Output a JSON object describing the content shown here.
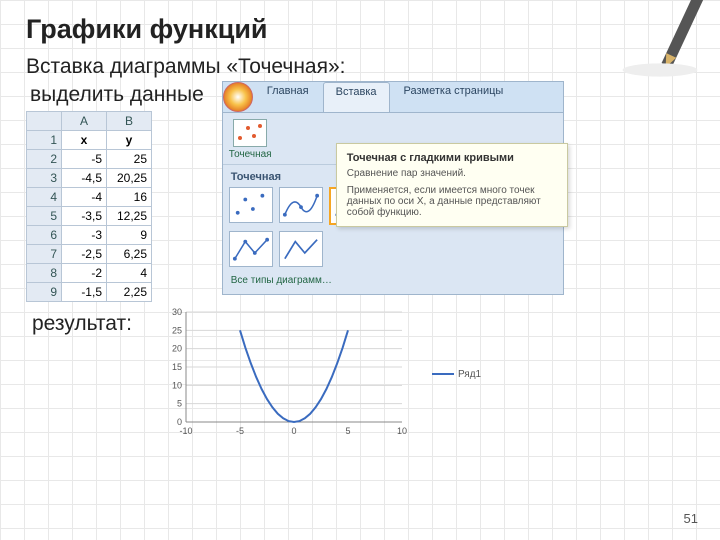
{
  "title": "Графики функций",
  "subtitle": "Вставка диаграммы «Точечная»:",
  "select_label": "выделить данные",
  "result_label": "результат:",
  "page": "51",
  "sheet": {
    "cols": [
      "A",
      "B"
    ],
    "head": [
      "x",
      "y"
    ],
    "rows": [
      {
        "n": "1",
        "a": "x",
        "b": "y",
        "isHead": true
      },
      {
        "n": "2",
        "a": "-5",
        "b": "25"
      },
      {
        "n": "3",
        "a": "-4,5",
        "b": "20,25"
      },
      {
        "n": "4",
        "a": "-4",
        "b": "16"
      },
      {
        "n": "5",
        "a": "-3,5",
        "b": "12,25"
      },
      {
        "n": "6",
        "a": "-3",
        "b": "9"
      },
      {
        "n": "7",
        "a": "-2,5",
        "b": "6,25"
      },
      {
        "n": "8",
        "a": "-2",
        "b": "4"
      },
      {
        "n": "9",
        "a": "-1,5",
        "b": "2,25"
      }
    ]
  },
  "ribbon": {
    "tabs": [
      "Главная",
      "Вставка",
      "Разметка страницы"
    ],
    "active_tab": 1,
    "button_label": "Точечная",
    "gallery_title": "Точечная",
    "all_types": "Все типы диаграмм…"
  },
  "tooltip": {
    "title": "Точечная с гладкими кривыми",
    "line1": "Сравнение пар значений.",
    "line2": "Применяется, если имеется много точек данных по оси X, а данные представляют собой функцию."
  },
  "legend": {
    "series": "Ряд1"
  },
  "chart_data": {
    "type": "line",
    "title": "",
    "xlabel": "",
    "ylabel": "",
    "x": [
      -10,
      -5,
      0,
      5,
      10
    ],
    "xlim": [
      -10,
      10
    ],
    "ylim": [
      0,
      30
    ],
    "yticks": [
      0,
      5,
      10,
      15,
      20,
      25,
      30
    ],
    "series": [
      {
        "name": "Ряд1",
        "x": [
          -5,
          -4.5,
          -4,
          -3.5,
          -3,
          -2.5,
          -2,
          -1.5,
          -1,
          -0.5,
          0,
          0.5,
          1,
          1.5,
          2,
          2.5,
          3,
          3.5,
          4,
          4.5,
          5
        ],
        "y": [
          25,
          20.25,
          16,
          12.25,
          9,
          6.25,
          4,
          2.25,
          1,
          0.25,
          0,
          0.25,
          1,
          2.25,
          4,
          6.25,
          9,
          12.25,
          16,
          20.25,
          25
        ]
      }
    ]
  }
}
